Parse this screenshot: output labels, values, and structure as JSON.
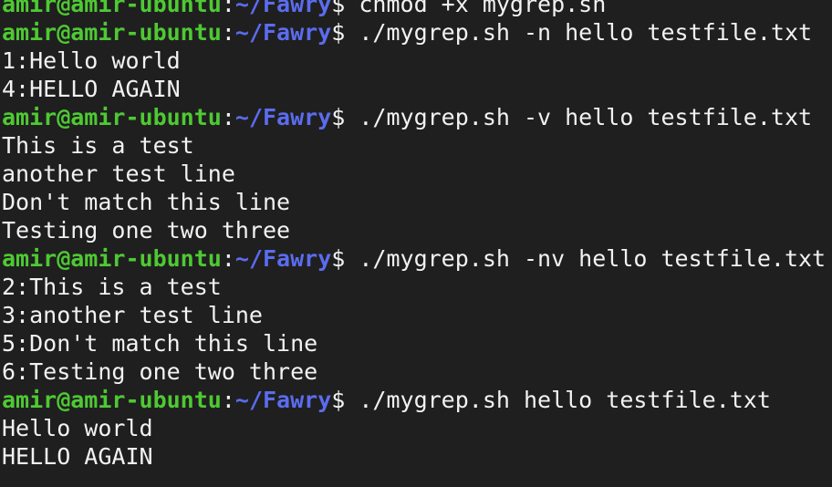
{
  "prompt": {
    "user_host": "amir@amir-ubuntu",
    "separator": ":",
    "path": "~/Fawry",
    "symbol": "$ "
  },
  "colors": {
    "background": "#1f1f1f",
    "user_host": "#4ec933",
    "path": "#5b6cf0",
    "text": "#f2f2f2"
  },
  "lines": [
    {
      "type": "command",
      "text": "chmod +x mygrep.sh"
    },
    {
      "type": "command",
      "text": "./mygrep.sh -n hello testfile.txt"
    },
    {
      "type": "output",
      "text": "1:Hello world"
    },
    {
      "type": "output",
      "text": "4:HELLO AGAIN"
    },
    {
      "type": "command",
      "text": "./mygrep.sh -v hello testfile.txt"
    },
    {
      "type": "output",
      "text": "This is a test"
    },
    {
      "type": "output",
      "text": "another test line"
    },
    {
      "type": "output",
      "text": "Don't match this line"
    },
    {
      "type": "output",
      "text": "Testing one two three"
    },
    {
      "type": "command",
      "text": "./mygrep.sh -nv hello testfile.txt"
    },
    {
      "type": "output",
      "text": "2:This is a test"
    },
    {
      "type": "output",
      "text": "3:another test line"
    },
    {
      "type": "output",
      "text": "5:Don't match this line"
    },
    {
      "type": "output",
      "text": "6:Testing one two three"
    },
    {
      "type": "command",
      "text": "./mygrep.sh hello testfile.txt"
    },
    {
      "type": "output",
      "text": "Hello world"
    },
    {
      "type": "output",
      "text": "HELLO AGAIN"
    }
  ]
}
